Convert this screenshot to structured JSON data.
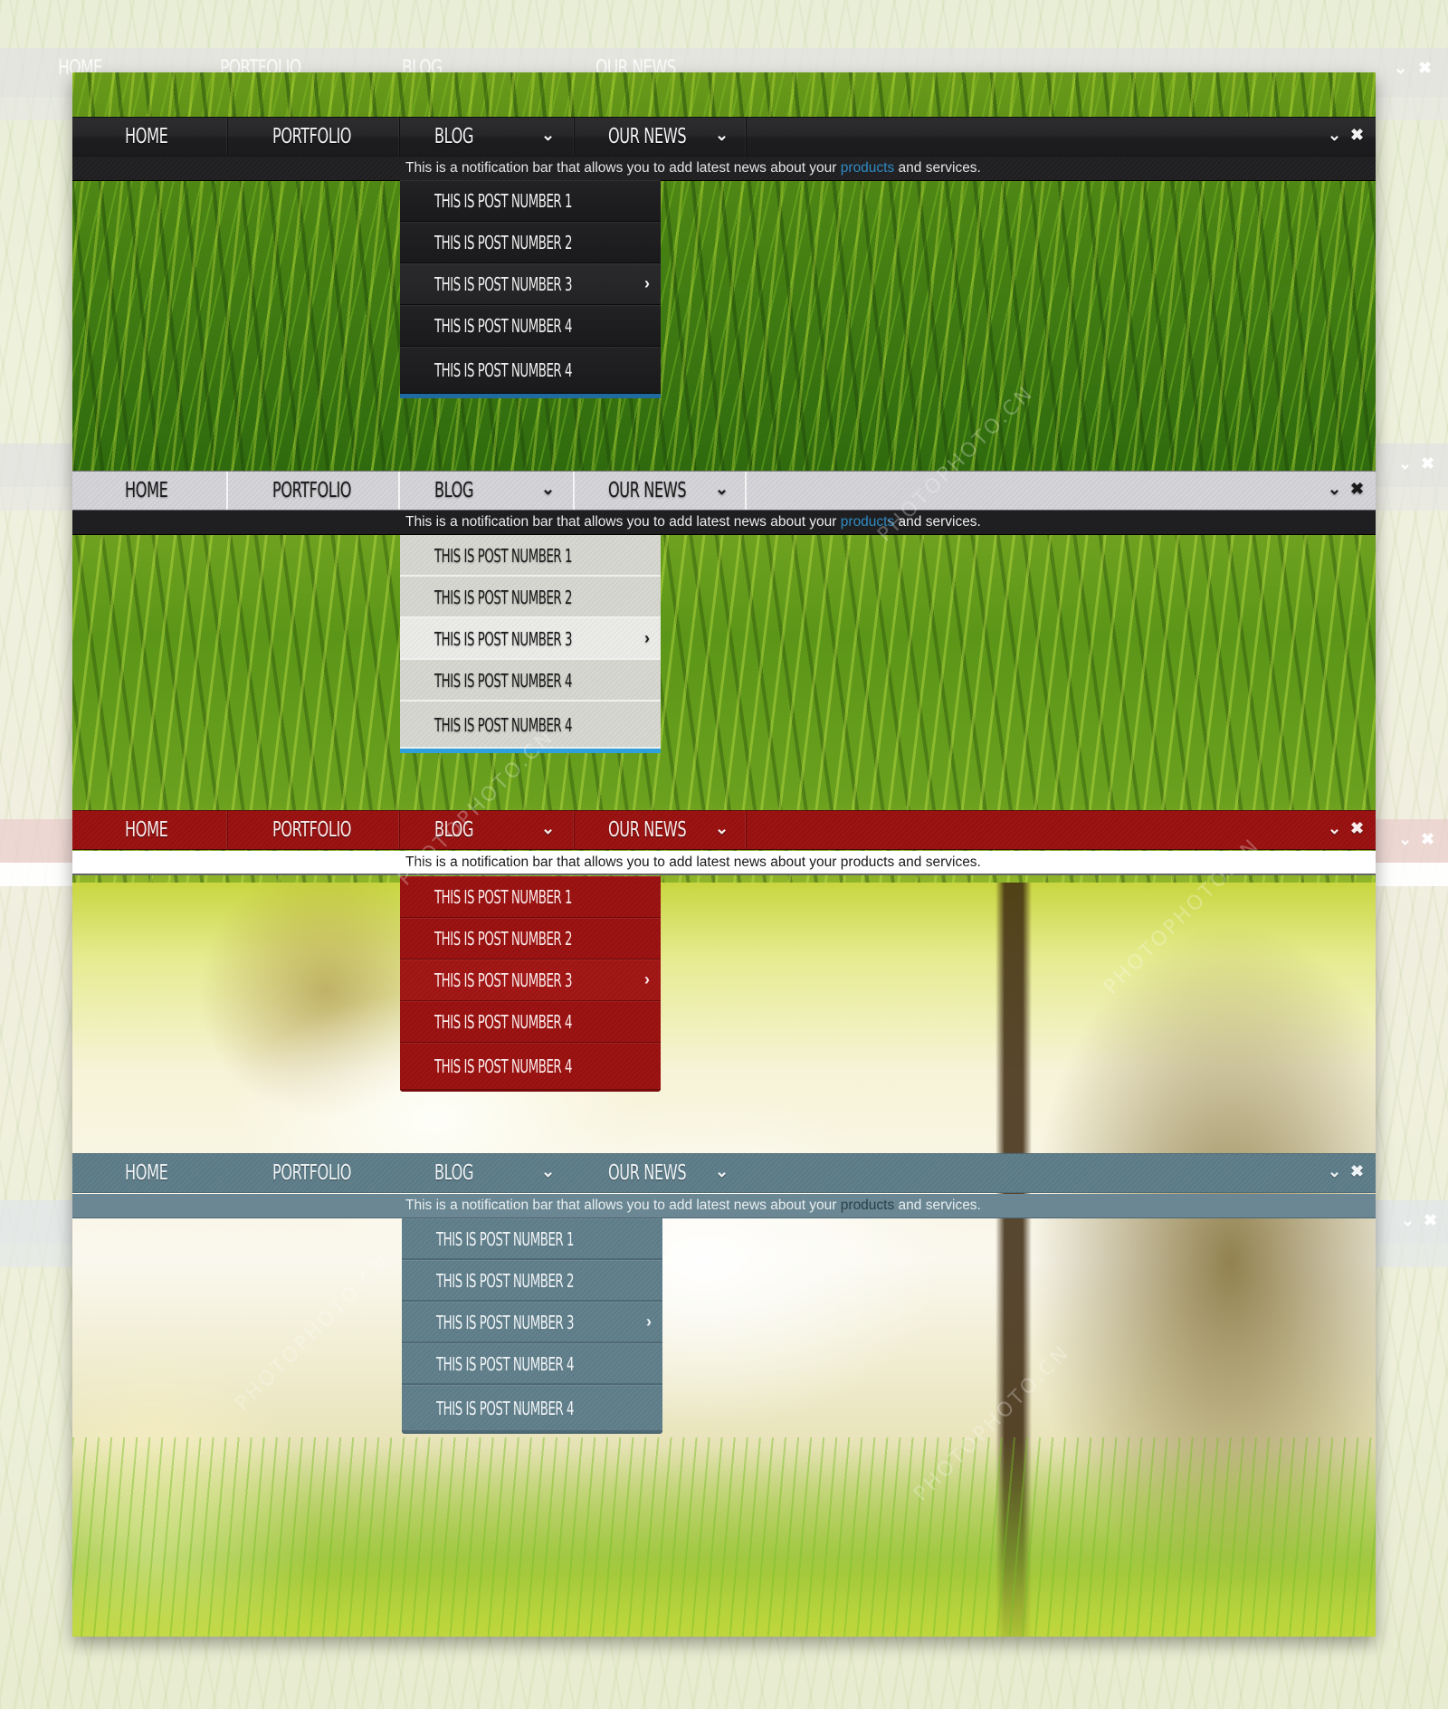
{
  "menu": {
    "items": [
      {
        "label": "HOME",
        "has_dropdown": false
      },
      {
        "label": "PORTFOLIO",
        "has_dropdown": false
      },
      {
        "label": "BLOG",
        "has_dropdown": true
      },
      {
        "label": "OUR NEWS",
        "has_dropdown": true
      }
    ],
    "controls": {
      "collapse_icon": "chevron-down-icon",
      "close_icon": "close-icon"
    },
    "caret_glyph": "⌄",
    "collapse_glyph": "⌄",
    "close_glyph": "✖",
    "arrow_glyph": "›"
  },
  "notification": {
    "before": "This is a notification bar that allows you to add latest news about your",
    "link": "products",
    "after": "and services."
  },
  "dropdown": {
    "items": [
      {
        "label": "THIS IS POST NUMBER 1",
        "has_submenu": false
      },
      {
        "label": "THIS IS POST NUMBER 2",
        "has_submenu": false
      },
      {
        "label": "THIS IS POST NUMBER 3",
        "has_submenu": true
      },
      {
        "label": "THIS IS POST NUMBER 4",
        "has_submenu": false
      },
      {
        "label": "THIS IS POST NUMBER 4",
        "has_submenu": false
      }
    ]
  },
  "themes": [
    {
      "name": "dark",
      "bar_color": "#222224",
      "accent": "#1f6aa0",
      "link_color": "#2f8ac2"
    },
    {
      "name": "light",
      "bar_color": "#d2d2d6",
      "accent": "#2fa0dc",
      "link_color": "#2f8ac2"
    },
    {
      "name": "red",
      "bar_color": "#981312",
      "accent": "#7a0c0c",
      "link_color": "#1a1a1a"
    },
    {
      "name": "slate",
      "bar_color": "#5e7d8a",
      "accent": "#4d6772",
      "link_color": "#2c3f47"
    }
  ],
  "watermark": "PHOTOPHOTO.CN"
}
